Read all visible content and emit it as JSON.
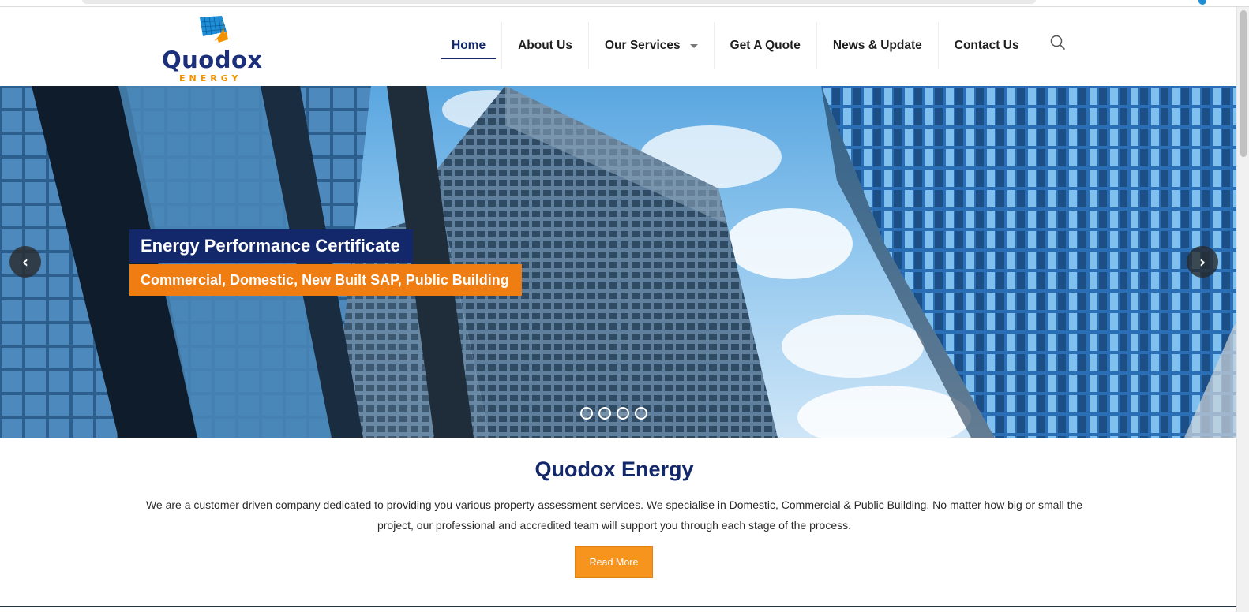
{
  "brand": {
    "name": "Quodox",
    "tagline": "ENERGY",
    "colors": {
      "navy": "#13276b",
      "orange": "#f39200",
      "logo_blue": "#1e8fd6"
    }
  },
  "nav": {
    "items": [
      {
        "label": "Home",
        "active": true
      },
      {
        "label": "About Us"
      },
      {
        "label": "Our Services",
        "has_dropdown": true
      },
      {
        "label": "Get A Quote"
      },
      {
        "label": "News & Update"
      },
      {
        "label": "Contact Us"
      }
    ],
    "search_icon": "search-icon"
  },
  "hero": {
    "title": "Energy Performance Certificate",
    "subtitle": "Commercial, Domestic, New Built SAP, Public Building",
    "prev_icon": "chevron-left-icon",
    "next_icon": "chevron-right-icon",
    "slide_count": 4
  },
  "intro": {
    "title": "Quodox Energy",
    "text": "We are a customer driven company dedicated to providing you various property assessment services. We specialise in Domestic, Commercial & Public Building. No matter how big or small the project, our professional and accredited team will support you through each stage of the process.",
    "button_label": "Read More"
  }
}
